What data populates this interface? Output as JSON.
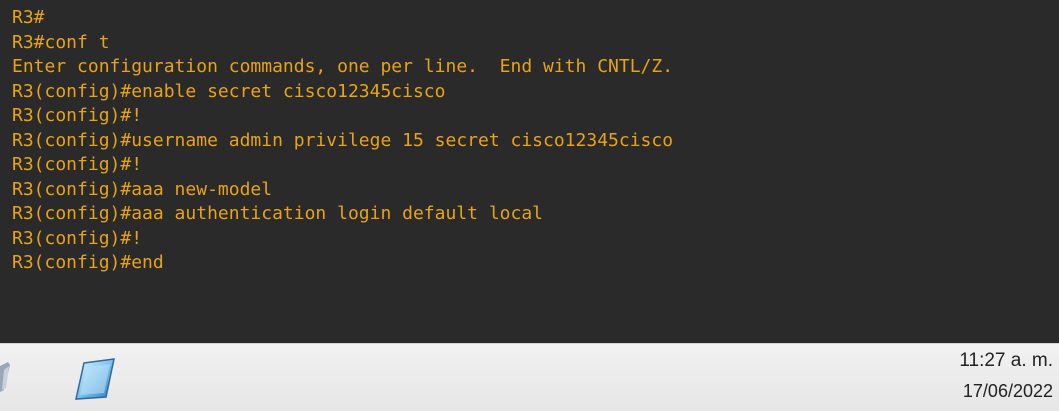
{
  "terminal": {
    "text_color": "#e8a317",
    "background_color": "#2a2a2a",
    "lines": [
      "R3#",
      "R3#conf t",
      "Enter configuration commands, one per line.  End with CNTL/Z.",
      "R3(config)#enable secret cisco12345cisco",
      "R3(config)#!",
      "R3(config)#username admin privilege 15 secret cisco12345cisco",
      "R3(config)#!",
      "R3(config)#aaa new-model",
      "R3(config)#aaa authentication login default local",
      "R3(config)#!",
      "R3(config)#end"
    ]
  },
  "taskbar": {
    "icons": [
      "app-icon-partial",
      "app-window-icon"
    ],
    "clock": {
      "time": "11:27 a. m.",
      "date": "17/06/2022"
    }
  }
}
